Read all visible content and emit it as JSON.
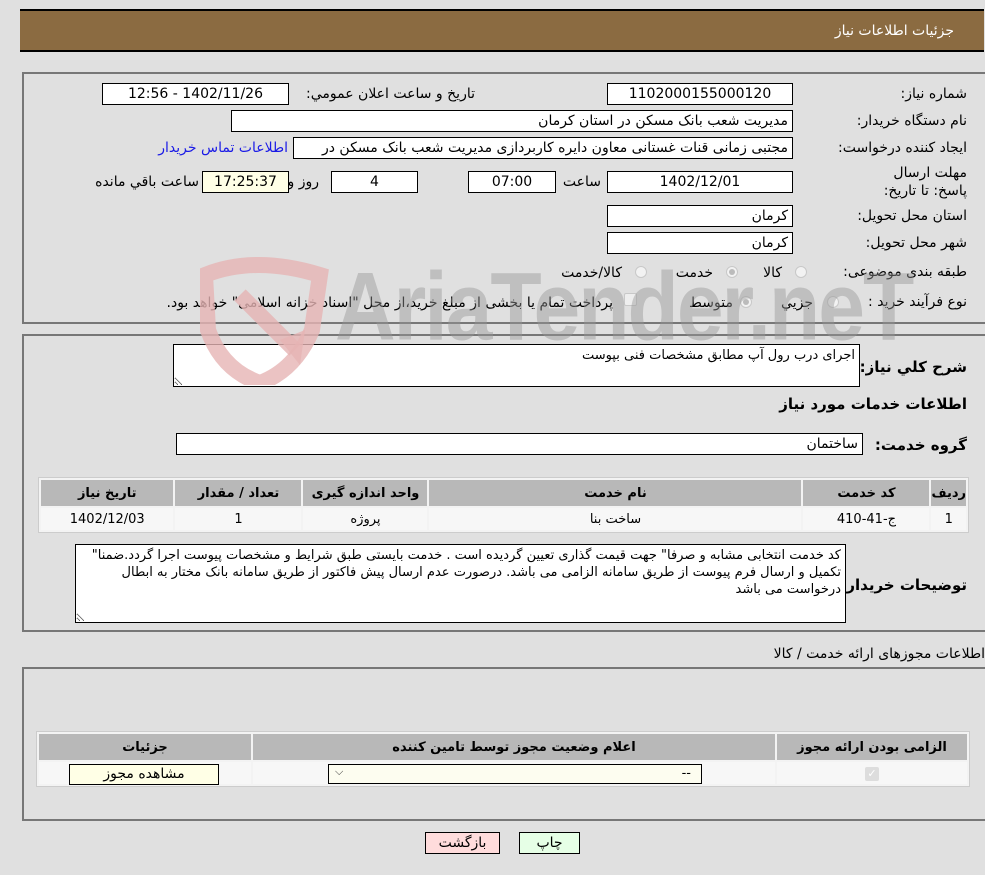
{
  "header": {
    "title": "جزئیات اطلاعات نیاز"
  },
  "form": {
    "need_number": {
      "label": "شماره نیاز:",
      "value": "1102000155000120"
    },
    "announce_datetime": {
      "label": "تاریخ و ساعت اعلان عمومي:",
      "value": "1402/11/26 - 12:56"
    },
    "buyer_org": {
      "label": "نام دستگاه خریدار:",
      "value": "مدیریت شعب بانک مسکن در استان کرمان"
    },
    "requester": {
      "label": "ایجاد کننده درخواست:",
      "value": "مجتبی زمانی قنات غستانی معاون دایره کاربردازی مدیریت شعب بانک مسکن در",
      "contact_link": "اطلاعات تماس خریدار"
    },
    "deadline": {
      "label": "مهلت ارسال پاسخ: تا تاریخ:",
      "date": "1402/12/01",
      "time_label": "ساعت",
      "time": "07:00",
      "days": "4",
      "days_label": "روز و",
      "remaining": "17:25:37",
      "remaining_label": "ساعت باقي مانده"
    },
    "delivery_province": {
      "label": "استان محل تحویل:",
      "value": "کرمان"
    },
    "delivery_city": {
      "label": "شهر محل تحویل:",
      "value": "کرمان"
    },
    "category": {
      "label": "طبقه بندی موضوعی:",
      "options": [
        "کالا",
        "خدمت",
        "کالا/خدمت"
      ],
      "selected": "خدمت"
    },
    "purchase_type": {
      "label": "نوع فرآیند خرید :",
      "options": [
        "جزيي",
        "متوسط"
      ],
      "selected": "متوسط",
      "treasury_checkbox_label": "پرداخت تمام یا بخشی از مبلغ خرید،از محل \"اسناد خزانه اسلامی\" خواهد بود."
    }
  },
  "description": {
    "label": "شرح كلي نیاز:",
    "value": "اجرای درب رول آپ مطابق مشخصات فنی بپوست"
  },
  "services": {
    "section_title": "اطلاعات خدمات مورد نیاز",
    "group_label": "گروه خدمت:",
    "group_value": "ساختمان",
    "columns": [
      "ردیف",
      "کد خدمت",
      "نام خدمت",
      "واحد اندازه گیری",
      "تعداد / مقدار",
      "تاریخ نیاز"
    ],
    "rows": [
      [
        "1",
        "ج-41-410",
        "ساخت بنا",
        "پروژه",
        "1",
        "1402/12/03"
      ]
    ]
  },
  "buyer_notes": {
    "label": "توضیحات خریدار:",
    "value": "کد خدمت انتخابی مشابه و صرفا\" جهت قیمت گذاری تعیین گردیده است . خدمت بایستی طبق شرایط و مشخصات پیوست اجرا گردد.ضمنا\" تکمیل و ارسال فرم پیوست از طریق سامانه الزامی می باشد. درصورت عدم ارسال پیش فاکتور از طریق سامانه بانک مختار به ابطال درخواست می باشد"
  },
  "permits": {
    "section_title": "اطلاعات مجوزهای ارائه خدمت / کالا",
    "columns": [
      "الزامی بودن ارائه مجوز",
      "اعلام وضعیت مجوز توسط تامین کننده",
      "جزئیات"
    ],
    "rows": [
      {
        "required_checked": true,
        "status_select": "--",
        "details_button": "مشاهده مجوز"
      }
    ]
  },
  "actions": {
    "print": "چاپ",
    "back": "بازگشت"
  },
  "watermark": {
    "text": "AriaTender.neT"
  },
  "colors": {
    "header_bg": "#8b6b41",
    "link": "#1a1ae6",
    "back_btn": "#ffdcdc",
    "print_btn": "#e6ffe6",
    "yellow_field": "#ffffe6"
  }
}
